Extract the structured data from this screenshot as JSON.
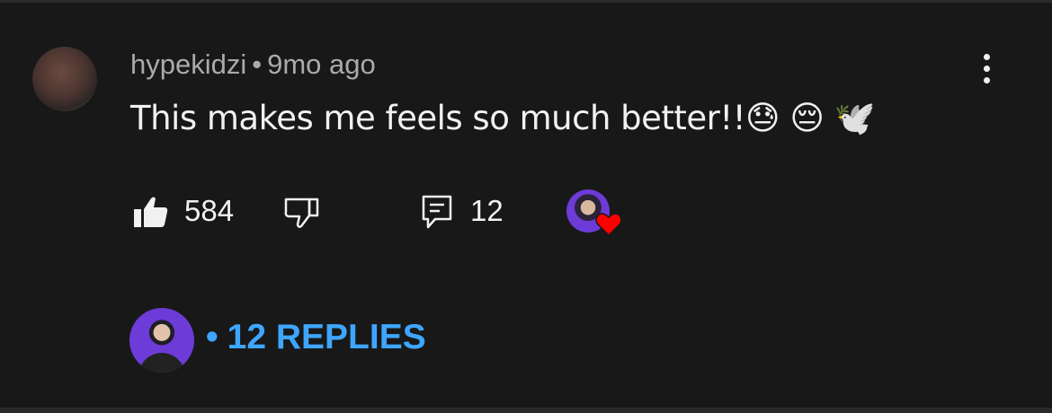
{
  "comment": {
    "author": "hypekidzi",
    "separator": "•",
    "time": "9mo ago",
    "text": "This makes me feels so much better!!😓 😔 🕊️",
    "likes": "584",
    "reply_count": "12"
  },
  "replies": {
    "dot": "•",
    "label": "12 REPLIES"
  },
  "icons": {
    "more": "kebab-menu-icon",
    "like": "thumbs-up-icon",
    "dislike": "thumbs-down-icon",
    "reply": "reply-comment-icon",
    "heart": "creator-heart-icon"
  },
  "colors": {
    "background": "#181818",
    "text": "#f1f1f1",
    "meta": "#aaaaaa",
    "link": "#3ea6ff",
    "heart": "#ff0000"
  }
}
